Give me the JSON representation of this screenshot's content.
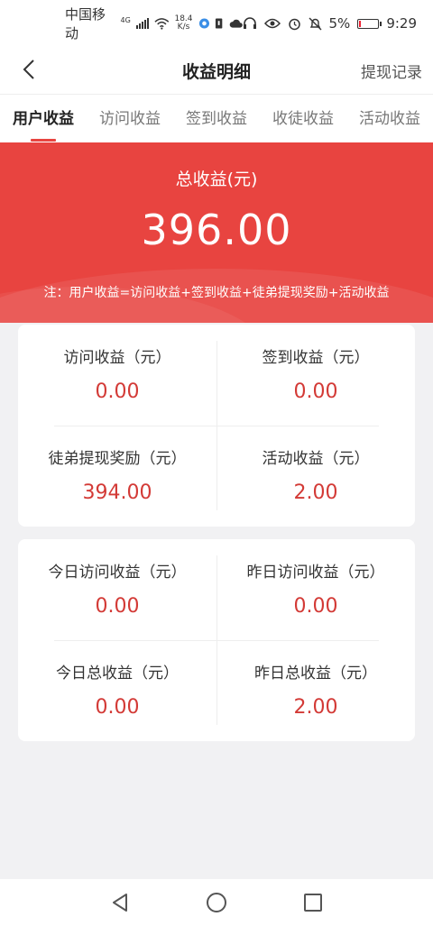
{
  "status": {
    "carrier": "中国移动",
    "network": "4G",
    "speed_top": "18.4",
    "speed_bottom": "K/s",
    "battery_pct": "5%",
    "time": "9:29"
  },
  "header": {
    "title": "收益明细",
    "right_link": "提现记录"
  },
  "tabs": [
    {
      "label": "用户收益",
      "active": true
    },
    {
      "label": "访问收益",
      "active": false
    },
    {
      "label": "签到收益",
      "active": false
    },
    {
      "label": "收徒收益",
      "active": false
    },
    {
      "label": "活动收益",
      "active": false
    }
  ],
  "summary": {
    "label": "总收益(元)",
    "value": "396.00",
    "note": "注：用户收益=访问收益+签到收益+徒弟提现奖励+活动收益"
  },
  "card1": [
    {
      "label": "访问收益（元）",
      "value": "0.00"
    },
    {
      "label": "签到收益（元）",
      "value": "0.00"
    },
    {
      "label": "徒弟提现奖励（元）",
      "value": "394.00"
    },
    {
      "label": "活动收益（元）",
      "value": "2.00"
    }
  ],
  "card2": [
    {
      "label": "今日访问收益（元）",
      "value": "0.00"
    },
    {
      "label": "昨日访问收益（元）",
      "value": "0.00"
    },
    {
      "label": "今日总收益（元）",
      "value": "0.00"
    },
    {
      "label": "昨日总收益（元）",
      "value": "2.00"
    }
  ],
  "colors": {
    "accent": "#e84440",
    "value_red": "#d33a36"
  }
}
